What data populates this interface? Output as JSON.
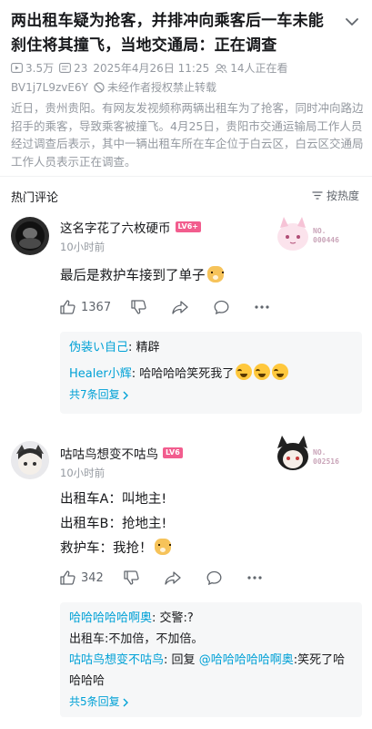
{
  "article": {
    "title": "两出租车疑为抢客，并排冲向乘客后一车未能刹住将其撞飞，当地交通局：正在调查",
    "views": "3.5万",
    "comments_count": "23",
    "datetime": "2025年4月26日 11:25",
    "watching": "14人正在看",
    "bvid": "BV1j7L9zvE6Y",
    "repost_notice": "未经作者授权禁止转载",
    "description": "近日，贵州贵阳。有网友发视频称两辆出租车为了抢客，同时冲向路边招手的乘客，导致乘客被撞飞。4月25日，贵阳市交通运输局工作人员经过调查后表示，其中一辆出租车所在车企位于白云区，白云区交通局工作人员表示正在调查。"
  },
  "comments_header": {
    "title": "热门评论",
    "sort_label": "按热度"
  },
  "comments": [
    {
      "user": "这名字花了六枚硬币",
      "level": "LV6+",
      "time": "10小时前",
      "fan_no": "NO.\n000446",
      "text": "最后是救护车接到了单子",
      "likes": "1367",
      "replies": [
        {
          "name": "伪装い自己",
          "text": "精辟"
        },
        {
          "name": "Healer小辉",
          "text": "哈哈哈哈笑死我了"
        }
      ],
      "more": "共7条回复"
    },
    {
      "user": "咕咕鸟想变不咕鸟",
      "level": "LV6",
      "time": "10小时前",
      "fan_no": "NO.\n002516",
      "lines": [
        "出租车A：叫地主!",
        "出租车B：抢地主!",
        "救护车：我抢！"
      ],
      "likes": "342",
      "replies": [
        {
          "name": "哈哈哈哈哈啊奥",
          "text": "交警:?"
        },
        {
          "name": "",
          "text": "出租车:不加倍，不加倍。"
        },
        {
          "name": "咕咕鸟想变不咕鸟",
          "text": "回复",
          "mention": "@哈哈哈哈哈啊奥",
          "tail": ":笑死了哈哈哈哈"
        }
      ],
      "more": "共5条回复"
    }
  ],
  "colors": {
    "link": "#00a1d6",
    "muted": "#9499a0",
    "level_badge": "#f25d8e"
  }
}
